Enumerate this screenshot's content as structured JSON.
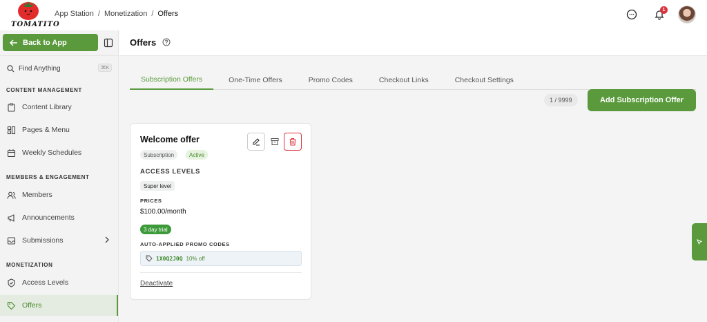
{
  "brand": {
    "name": "TOMATITO",
    "accent": "#5a9a3c",
    "danger": "#d9343d"
  },
  "breadcrumb": {
    "items": [
      "App Station",
      "Monetization",
      "Offers"
    ],
    "separator": "/"
  },
  "header": {
    "notification_count": "1"
  },
  "sidebar": {
    "back_label": "Back to App",
    "search_placeholder": "Find Anything",
    "search_shortcut": "⌘K",
    "sections": [
      {
        "title": "CONTENT MANAGEMENT",
        "items": [
          {
            "label": "Content Library",
            "icon": "clipboard-icon"
          },
          {
            "label": "Pages & Menu",
            "icon": "layout-icon"
          },
          {
            "label": "Weekly Schedules",
            "icon": "calendar-icon"
          }
        ]
      },
      {
        "title": "MEMBERS & ENGAGEMENT",
        "items": [
          {
            "label": "Members",
            "icon": "users-icon"
          },
          {
            "label": "Announcements",
            "icon": "megaphone-icon"
          },
          {
            "label": "Submissions",
            "icon": "inbox-icon"
          }
        ]
      },
      {
        "title": "MONETIZATION",
        "items": [
          {
            "label": "Access Levels",
            "icon": "shield-icon"
          },
          {
            "label": "Offers",
            "icon": "tag-icon",
            "active": true
          }
        ]
      }
    ]
  },
  "main": {
    "title": "Offers",
    "tabs": [
      "Subscription Offers",
      "One-Time Offers",
      "Promo Codes",
      "Checkout Links",
      "Checkout Settings"
    ],
    "active_tab": "Subscription Offers",
    "counter": "1 / 9999",
    "add_button": "Add Subscription Offer"
  },
  "offer": {
    "title": "Welcome offer",
    "type": "Subscription",
    "status": "Active",
    "access_levels_label": "ACCESS LEVELS",
    "access_level": "Super level",
    "prices_label": "PRICES",
    "price": "$100.00/month",
    "trial": "3 day trial",
    "promo_label": "AUTO-APPLIED PROMO CODES",
    "promo_code": "1X0Q2J0Q",
    "promo_discount": "10% off",
    "deactivate": "Deactivate"
  }
}
